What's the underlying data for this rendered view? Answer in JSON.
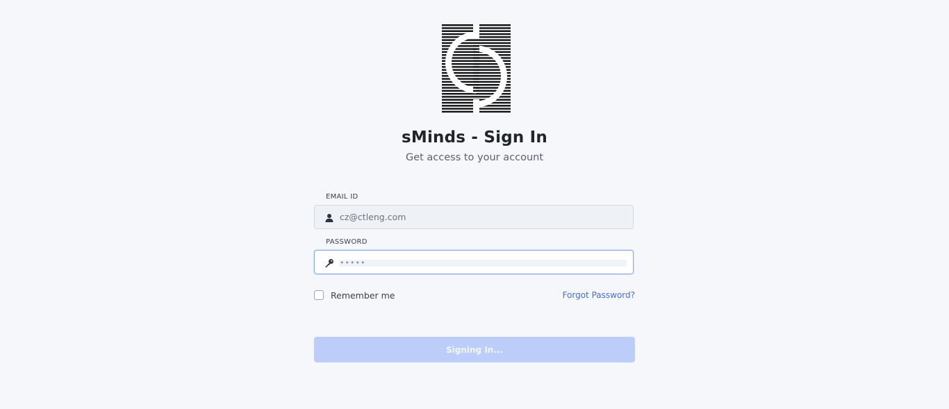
{
  "app": {
    "logo_icon": "sminds-logo-icon",
    "title": "sMinds - Sign In",
    "subtitle": "Get access to your account"
  },
  "form": {
    "email": {
      "label": "EMAIL ID",
      "value": "cz@ctleng.com",
      "icon": "user-icon"
    },
    "password": {
      "label": "PASSWORD",
      "value": "•••••",
      "icon": "key-icon"
    },
    "remember_label": "Remember me",
    "remember_checked": false,
    "forgot_label": "Forgot Password?",
    "submit_label": "Signing In..."
  },
  "colors": {
    "background": "#f5f7fa",
    "accent": "#3f6fd8",
    "button_disabled": "#bccdfa",
    "focus_border": "#8eaef0"
  }
}
